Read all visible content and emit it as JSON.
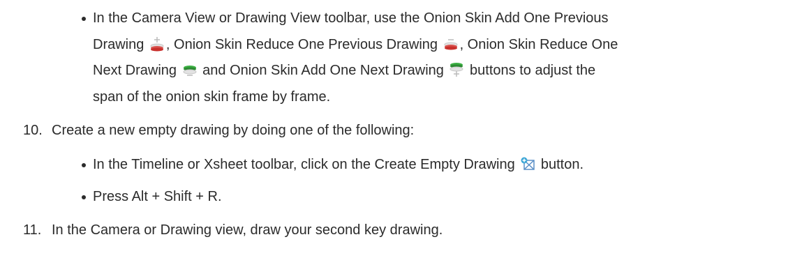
{
  "item_onion_bullet": {
    "line1": "In the Camera View or Drawing View toolbar, use the Onion Skin Add One Previous",
    "seg_a": "Drawing ",
    "seg_b": ", Onion Skin Reduce One Previous Drawing ",
    "seg_c": ", Onion Skin Reduce One",
    "seg_d": "Next Drawing ",
    "seg_e": " and Onion Skin Add One Next Drawing ",
    "seg_f": " buttons to adjust the",
    "line4": "span of the onion skin frame by frame."
  },
  "step10": {
    "number": "10.",
    "text": "Create a new empty drawing by doing one of the following:",
    "bullet1_a": "In the Timeline or Xsheet toolbar, click on the Create Empty Drawing ",
    "bullet1_b": " button.",
    "bullet2": "Press Alt + Shift + R."
  },
  "step11": {
    "number": "11.",
    "text": "In the Camera or Drawing view, draw your second key drawing."
  },
  "icons": {
    "add_prev": "onion-skin-add-one-previous-icon",
    "reduce_prev": "onion-skin-reduce-one-previous-icon",
    "reduce_next": "onion-skin-reduce-one-next-icon",
    "add_next": "onion-skin-add-one-next-icon",
    "create_empty": "create-empty-drawing-icon"
  },
  "colors": {
    "text": "#2b2b2b",
    "onion_red": "#d9534f",
    "onion_green": "#3cb043"
  }
}
